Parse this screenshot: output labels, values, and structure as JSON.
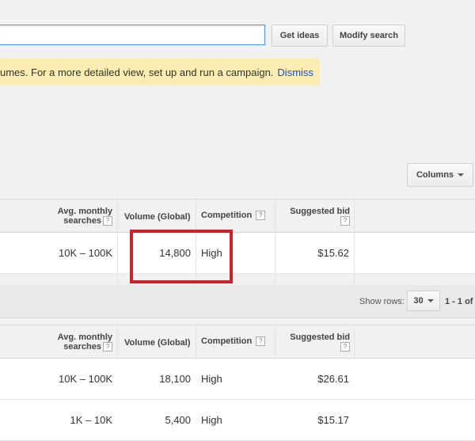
{
  "search": {
    "value": "",
    "placeholder": ""
  },
  "toolbar": {
    "get_ideas_label": "Get ideas",
    "modify_search_label": "Modify search"
  },
  "notice": {
    "text": "umes. For a more detailed view, set up and run a campaign.",
    "dismiss_label": "Dismiss"
  },
  "columns_button": {
    "label": "Columns"
  },
  "table1": {
    "headers": {
      "avg_line1": "Avg. monthly",
      "avg_line2": "searches",
      "volume": "Volume (Global)",
      "competition": "Competition",
      "bid": "Suggested bid",
      "help": "?"
    },
    "rows": [
      {
        "avg": "10K – 100K",
        "volume": "14,800",
        "competition": "High",
        "bid": "$15.62"
      }
    ]
  },
  "pager": {
    "show_rows_label": "Show rows:",
    "rows_value": "30",
    "range": "1 - 1 of"
  },
  "table2": {
    "headers": {
      "avg_line1": "Avg. monthly",
      "avg_line2": "searches",
      "volume": "Volume (Global)",
      "competition": "Competition",
      "bid": "Suggested bid",
      "help": "?"
    },
    "rows": [
      {
        "avg": "10K – 100K",
        "volume": "18,100",
        "competition": "High",
        "bid": "$26.61"
      },
      {
        "avg": "1K – 10K",
        "volume": "5,400",
        "competition": "High",
        "bid": "$15.17"
      }
    ]
  },
  "colors": {
    "accent_link": "#1155cc",
    "notice_bg": "#fbecb2",
    "highlight": "#d0202a"
  }
}
